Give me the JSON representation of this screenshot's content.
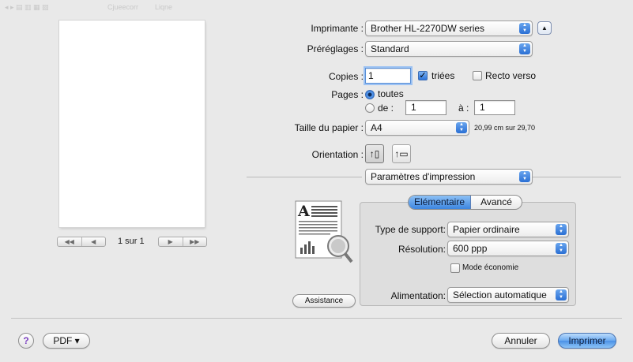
{
  "ghost_toolbar": {
    "item_a": "Cjueecorr",
    "item_b": "Liqne"
  },
  "preview": {
    "page_count": "1 sur 1",
    "nav_first": "◀◀",
    "nav_prev": "◀",
    "nav_next": "▶",
    "nav_last": "▶▶"
  },
  "printer": {
    "label": "Imprimante :",
    "value": "Brother HL-2270DW series",
    "disclosure": "▲"
  },
  "presets": {
    "label": "Préréglages :",
    "value": "Standard"
  },
  "copies": {
    "label": "Copies :",
    "value": "1",
    "collated_label": "triées",
    "collated_checked": true,
    "duplex_label": "Recto verso",
    "duplex_checked": false
  },
  "pages": {
    "label": "Pages :",
    "all_label": "toutes",
    "range_label": "de :",
    "from_value": "1",
    "to_label": "à :",
    "to_value": "1"
  },
  "paper_size": {
    "label": "Taille du papier :",
    "value": "A4",
    "dimensions": "20,99 cm sur 29,70"
  },
  "orientation": {
    "label": "Orientation :",
    "portrait_glyph": "↑▯",
    "landscape_glyph": "↑▭"
  },
  "section_popup": {
    "value": "Paramètres d'impression"
  },
  "tabs": [
    {
      "label": "Elémentaire",
      "active": true
    },
    {
      "label": "Avancé",
      "active": false
    }
  ],
  "settings": {
    "media_type": {
      "label": "Type de support:",
      "value": "Papier ordinaire"
    },
    "resolution": {
      "label": "Résolution:",
      "value": "600 ppp"
    },
    "toner_save": {
      "label": "Mode économie",
      "checked": false
    },
    "paper_source": {
      "label": "Alimentation:",
      "value": "Sélection automatique"
    }
  },
  "support_button": "Assistance",
  "footer": {
    "help": "?",
    "pdf": "PDF ▾",
    "cancel": "Annuler",
    "print": "Imprimer"
  },
  "colors": {
    "accent": "#3c85e0",
    "window_bg": "#e9e9e9",
    "help_purple": "#7b3fc0"
  }
}
